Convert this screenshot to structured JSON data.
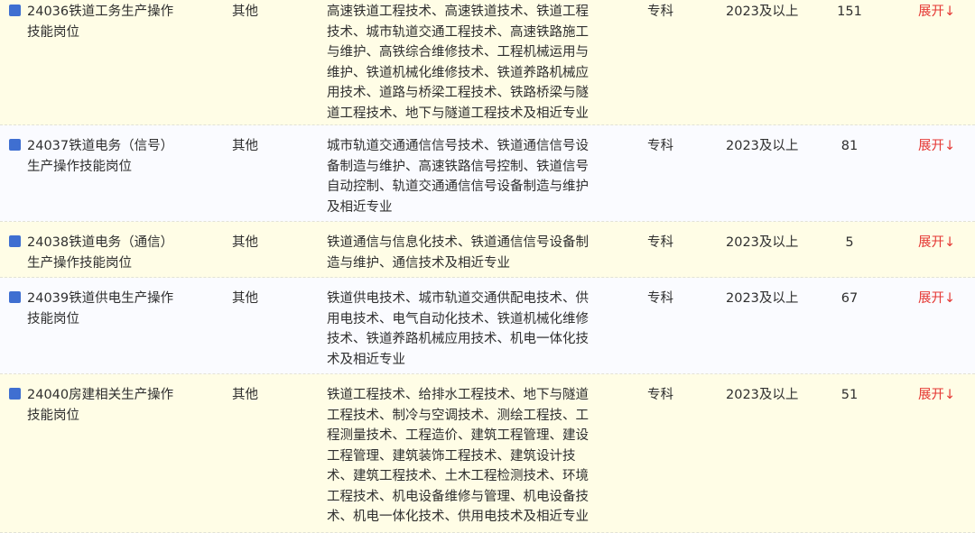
{
  "rows": [
    {
      "name_line1": "24036铁道工务生产操作",
      "name_line2": "技能岗位",
      "type": "其他",
      "major_lines": [
        "高速铁道工程技术、高速铁道技术、铁道工程",
        "技术、城市轨道交通工程技术、高速铁路施工",
        "与维护、高铁综合维修技术、工程机械运用与",
        "维护、铁道机械化维修技术、铁道养路机械应",
        "用技术、道路与桥梁工程技术、铁路桥梁与隧",
        "道工程技术、地下与隧道工程技术及相近专业"
      ],
      "education": "专科",
      "year": "2023及以上",
      "count": "151",
      "expand": "展开↓"
    },
    {
      "name_line1": "24037铁道电务（信号）",
      "name_line2": "生产操作技能岗位",
      "type": "其他",
      "major_lines": [
        "城市轨道交通通信信号技术、铁道通信信号设",
        "备制造与维护、高速铁路信号控制、铁道信号",
        "自动控制、轨道交通通信信号设备制造与维护",
        "及相近专业"
      ],
      "education": "专科",
      "year": "2023及以上",
      "count": "81",
      "expand": "展开↓"
    },
    {
      "name_line1": "24038铁道电务（通信）",
      "name_line2": "生产操作技能岗位",
      "type": "其他",
      "major_lines": [
        "铁道通信与信息化技术、铁道通信信号设备制",
        "造与维护、通信技术及相近专业"
      ],
      "education": "专科",
      "year": "2023及以上",
      "count": "5",
      "expand": "展开↓"
    },
    {
      "name_line1": "24039铁道供电生产操作",
      "name_line2": "技能岗位",
      "type": "其他",
      "major_lines": [
        "铁道供电技术、城市轨道交通供配电技术、供",
        "用电技术、电气自动化技术、铁道机械化维修",
        "技术、铁道养路机械应用技术、机电一体化技",
        "术及相近专业"
      ],
      "education": "专科",
      "year": "2023及以上",
      "count": "67",
      "expand": "展开↓"
    },
    {
      "name_line1": "24040房建相关生产操作",
      "name_line2": "技能岗位",
      "type": "其他",
      "major_lines": [
        "铁道工程技术、给排水工程技术、地下与隧道",
        "工程技术、制冷与空调技术、测绘工程技、工",
        "程测量技术、工程造价、建筑工程管理、建设",
        "工程管理、建筑装饰工程技术、建筑设计技",
        "术、建筑工程技术、土木工程检测技术、环境",
        "工程技术、机电设备维修与管理、机电设备技",
        "术、机电一体化技术、供用电技术及相近专业"
      ],
      "education": "专科",
      "year": "2023及以上",
      "count": "51",
      "expand": "展开↓"
    }
  ]
}
